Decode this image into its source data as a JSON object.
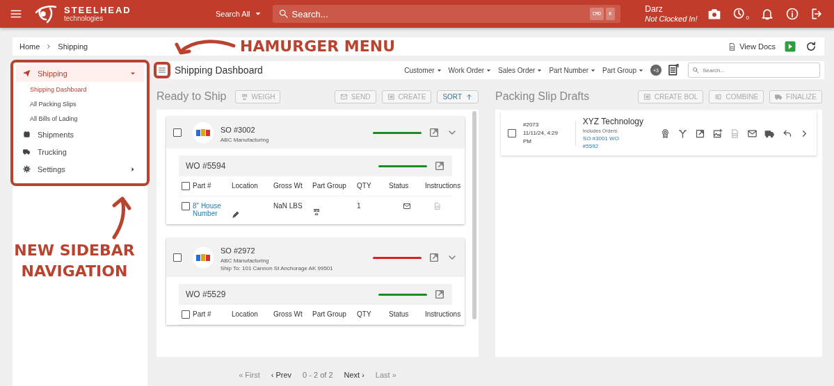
{
  "top_bar": {
    "brand": "STEELHEAD",
    "brand_sub": "technologies",
    "search_scope": "Search All",
    "search_placeholder": "Search...",
    "shortcut_keys": [
      "CMD",
      "K"
    ],
    "user_name": "Darz",
    "clock_status": "Not Clocked In!",
    "timer_count": "0"
  },
  "breadcrumb": {
    "items": [
      "Home",
      "Shipping"
    ],
    "view_docs": "View Docs"
  },
  "sidebar": {
    "items": [
      {
        "label": "Shipping",
        "kind": "group",
        "expanded": true,
        "selected": true,
        "children": [
          {
            "label": "Shipping Dashboard",
            "selected": true
          },
          {
            "label": "All Packing Slips",
            "selected": false
          },
          {
            "label": "All Bills of Lading",
            "selected": false
          }
        ]
      },
      {
        "label": "Shipments",
        "kind": "link",
        "selected": false
      },
      {
        "label": "Trucking",
        "kind": "link",
        "selected": false
      },
      {
        "label": "Settings",
        "kind": "group",
        "expanded": false,
        "selected": false
      }
    ]
  },
  "dashboard": {
    "title": "Shipping Dashboard",
    "filters": [
      "Customer",
      "Work Order",
      "Sales Order",
      "Part Number",
      "Part Group"
    ],
    "more_filters": "+3",
    "search_placeholder": "Search..."
  },
  "ready_to_ship": {
    "title": "Ready to Ship",
    "actions": [
      {
        "label": "WEIGH",
        "disabled": true
      },
      {
        "label": "SEND",
        "disabled": true
      },
      {
        "label": "CREATE",
        "disabled": true
      }
    ],
    "sort": {
      "label": "SORT",
      "disabled": false
    },
    "orders": [
      {
        "so": "SO #3002",
        "customer": "ABC Manufacturing",
        "checked": false,
        "color": "#1e8a22",
        "work_orders": [
          {
            "wo": "WO #5594",
            "color": "#1e8a22",
            "all_checked": false,
            "columns": [
              "Part #",
              "Location",
              "Gross Wt",
              "Part Group",
              "QTY",
              "Status",
              "Instructions"
            ],
            "rows": [
              {
                "part": "8\" House Number",
                "gross_wt": "NaN LBS",
                "qty": "1",
                "checked": false
              }
            ]
          }
        ]
      },
      {
        "so": "SO #2972",
        "customer": "ABC Manufacturing",
        "ship_to": "Ship To: 101 Cannon St Anchorage AK 99501",
        "checked": false,
        "color": "#d42222",
        "work_orders": [
          {
            "wo": "WO #5529",
            "color": "#1e8a22",
            "all_checked": false,
            "columns": [
              "Part #",
              "Location",
              "Gross Wt",
              "Part Group",
              "QTY",
              "Status",
              "Instructions"
            ]
          }
        ]
      }
    ]
  },
  "packing_slip_drafts": {
    "title": "Packing Slip Drafts",
    "actions": [
      {
        "label": "CREATE BOL",
        "disabled": true
      },
      {
        "label": "COMBINE",
        "disabled": true
      },
      {
        "label": "FINALIZE",
        "disabled": true
      }
    ],
    "drafts": [
      {
        "number": "#2073",
        "date": "11/11/24, 4:29 PM",
        "customer": "XYZ Technology",
        "includes_label": "Includes Orders:",
        "orders_link": "SO #3001 WO #5592",
        "checked": false
      }
    ]
  },
  "pagination": [
    {
      "label": "« First",
      "disabled": true
    },
    {
      "label": "‹ Prev",
      "disabled": false
    },
    {
      "label": "0 - 2 of 2",
      "kind": "range"
    },
    {
      "label": "Next ›",
      "disabled": false
    },
    {
      "label": "Last »",
      "disabled": true
    }
  ],
  "annotations": [
    {
      "text": "HAMURGER MENU"
    },
    {
      "text": "NEW SIDEBAR NAVIGATION"
    }
  ]
}
